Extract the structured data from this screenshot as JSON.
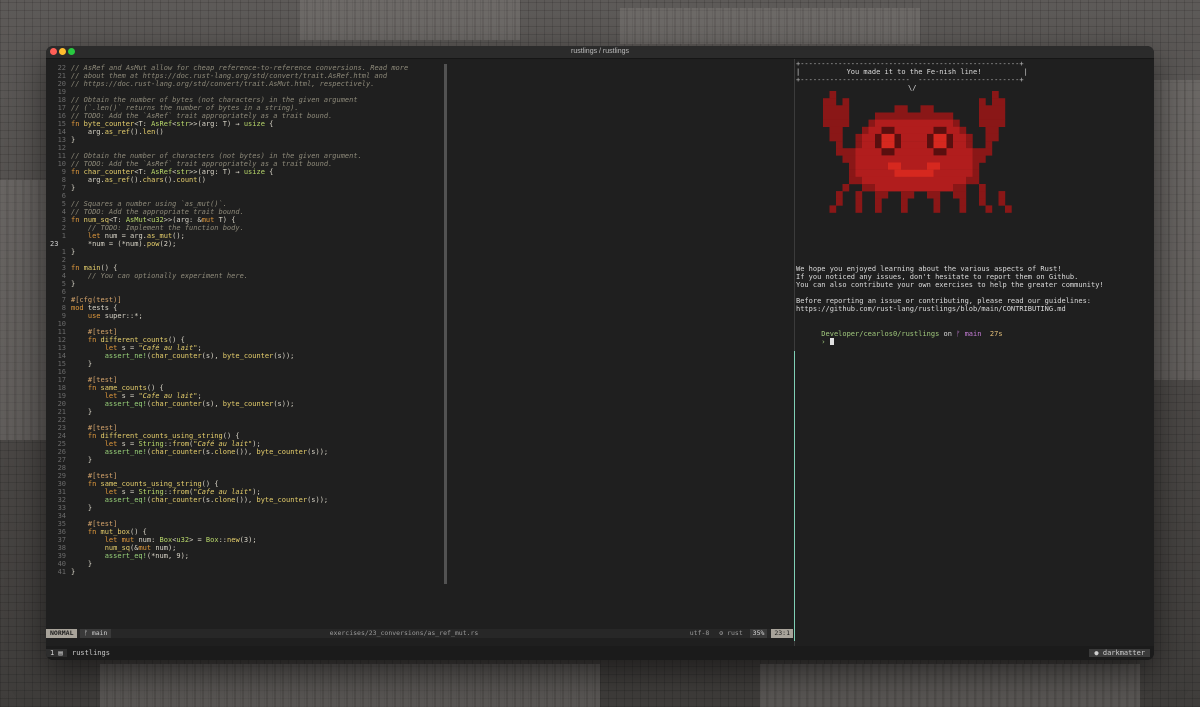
{
  "window": {
    "title": "rustlings / rustlings"
  },
  "editor": {
    "lines": [
      {
        "n": "22",
        "segs": [
          {
            "t": "// ",
            "c": "c-com"
          },
          {
            "t": "AsRef",
            "c": "c-com"
          },
          {
            "t": " and ",
            "c": "c-com"
          },
          {
            "t": "AsMut",
            "c": "c-com"
          },
          {
            "t": " allow for cheap reference-to-reference conversions. Read more",
            "c": "c-com"
          }
        ]
      },
      {
        "n": "21",
        "segs": [
          {
            "t": "// about them at https://doc.rust-lang.org/std/convert/trait.AsRef.html and",
            "c": "c-com"
          }
        ]
      },
      {
        "n": "20",
        "segs": [
          {
            "t": "// https://doc.rust-lang.org/std/convert/trait.AsMut.html, respectively.",
            "c": "c-com"
          }
        ]
      },
      {
        "n": "19",
        "segs": []
      },
      {
        "n": "18",
        "segs": [
          {
            "t": "// Obtain the number of bytes (not characters) in the given argument",
            "c": "c-com"
          }
        ]
      },
      {
        "n": "17",
        "segs": [
          {
            "t": "// (`.len()` returns the number of bytes in a string).",
            "c": "c-com"
          }
        ]
      },
      {
        "n": "16",
        "segs": [
          {
            "t": "// TODO: Add the `AsRef` trait appropriately as a trait bound.",
            "c": "c-com"
          }
        ]
      },
      {
        "n": "15",
        "segs": [
          {
            "t": "fn ",
            "c": "c-kw"
          },
          {
            "t": "byte_counter",
            "c": "c-fn"
          },
          {
            "t": "<T: "
          },
          {
            "t": "AsRef",
            "c": "c-type"
          },
          {
            "t": "<"
          },
          {
            "t": "str",
            "c": "c-type"
          },
          {
            "t": ">>(arg: T) → "
          },
          {
            "t": "usize",
            "c": "c-type"
          },
          {
            "t": " {"
          }
        ]
      },
      {
        "n": "14",
        "segs": [
          {
            "t": "    arg."
          },
          {
            "t": "as_ref",
            "c": "c-fn"
          },
          {
            "t": "()."
          },
          {
            "t": "len",
            "c": "c-fn"
          },
          {
            "t": "()"
          }
        ]
      },
      {
        "n": "13",
        "segs": [
          {
            "t": "}"
          }
        ]
      },
      {
        "n": "12",
        "segs": []
      },
      {
        "n": "11",
        "segs": [
          {
            "t": "// Obtain the number of characters (not bytes) in the given argument.",
            "c": "c-com"
          }
        ]
      },
      {
        "n": "10",
        "segs": [
          {
            "t": "// TODO: Add the `AsRef` trait appropriately as a trait bound.",
            "c": "c-com"
          }
        ]
      },
      {
        "n": "9",
        "segs": [
          {
            "t": "fn ",
            "c": "c-kw"
          },
          {
            "t": "char_counter",
            "c": "c-fn"
          },
          {
            "t": "<T: "
          },
          {
            "t": "AsRef",
            "c": "c-type"
          },
          {
            "t": "<"
          },
          {
            "t": "str",
            "c": "c-type"
          },
          {
            "t": ">>(arg: T) → "
          },
          {
            "t": "usize",
            "c": "c-type"
          },
          {
            "t": " {"
          }
        ]
      },
      {
        "n": "8",
        "segs": [
          {
            "t": "    arg."
          },
          {
            "t": "as_ref",
            "c": "c-fn"
          },
          {
            "t": "()."
          },
          {
            "t": "chars",
            "c": "c-fn"
          },
          {
            "t": "()."
          },
          {
            "t": "count",
            "c": "c-fn"
          },
          {
            "t": "()"
          }
        ]
      },
      {
        "n": "7",
        "segs": [
          {
            "t": "}"
          }
        ]
      },
      {
        "n": "6",
        "segs": []
      },
      {
        "n": "5",
        "segs": [
          {
            "t": "// Squares a number using `as_mut()`.",
            "c": "c-com"
          }
        ]
      },
      {
        "n": "4",
        "segs": [
          {
            "t": "// TODO: Add the appropriate trait bound.",
            "c": "c-com"
          }
        ]
      },
      {
        "n": "3",
        "segs": [
          {
            "t": "fn ",
            "c": "c-kw"
          },
          {
            "t": "num_sq",
            "c": "c-fn"
          },
          {
            "t": "<T: "
          },
          {
            "t": "AsMut",
            "c": "c-type"
          },
          {
            "t": "<"
          },
          {
            "t": "u32",
            "c": "c-type"
          },
          {
            "t": ">>(arg: &"
          },
          {
            "t": "mut",
            "c": "c-kw"
          },
          {
            "t": " T) {"
          }
        ]
      },
      {
        "n": "2",
        "segs": [
          {
            "t": "    "
          },
          {
            "t": "// TODO: Implement the function body.",
            "c": "c-com"
          }
        ]
      },
      {
        "n": "1",
        "segs": [
          {
            "t": "    "
          },
          {
            "t": "let",
            "c": "c-kw"
          },
          {
            "t": " num = arg."
          },
          {
            "t": "as_mut",
            "c": "c-fn"
          },
          {
            "t": "();"
          }
        ]
      },
      {
        "n": "23",
        "cur": true,
        "segs": [
          {
            "t": "    *num = (*num)."
          },
          {
            "t": "pow",
            "c": "c-fn"
          },
          {
            "t": "(2);"
          }
        ]
      },
      {
        "n": "1",
        "segs": [
          {
            "t": "}"
          }
        ]
      },
      {
        "n": "2",
        "segs": []
      },
      {
        "n": "3",
        "segs": [
          {
            "t": "fn ",
            "c": "c-kw"
          },
          {
            "t": "main",
            "c": "c-fn"
          },
          {
            "t": "() {"
          }
        ]
      },
      {
        "n": "4",
        "segs": [
          {
            "t": "    "
          },
          {
            "t": "// You can optionally experiment here.",
            "c": "c-com"
          }
        ]
      },
      {
        "n": "5",
        "segs": [
          {
            "t": "}"
          }
        ]
      },
      {
        "n": "6",
        "segs": []
      },
      {
        "n": "7",
        "segs": [
          {
            "t": "#[cfg(test)]",
            "c": "c-attr"
          }
        ]
      },
      {
        "n": "8",
        "segs": [
          {
            "t": "mod ",
            "c": "c-kw"
          },
          {
            "t": "tests {"
          }
        ]
      },
      {
        "n": "9",
        "segs": [
          {
            "t": "    "
          },
          {
            "t": "use",
            "c": "c-kw"
          },
          {
            "t": " super::*;"
          }
        ]
      },
      {
        "n": "10",
        "segs": []
      },
      {
        "n": "11",
        "segs": [
          {
            "t": "    "
          },
          {
            "t": "#[test]",
            "c": "c-attr"
          }
        ]
      },
      {
        "n": "12",
        "segs": [
          {
            "t": "    "
          },
          {
            "t": "fn ",
            "c": "c-kw"
          },
          {
            "t": "different_counts",
            "c": "c-fn"
          },
          {
            "t": "() {"
          }
        ]
      },
      {
        "n": "13",
        "segs": [
          {
            "t": "        "
          },
          {
            "t": "let",
            "c": "c-kw"
          },
          {
            "t": " s = "
          },
          {
            "t": "\"Café au lait\"",
            "c": "c-str"
          },
          {
            "t": ";"
          }
        ]
      },
      {
        "n": "14",
        "segs": [
          {
            "t": "        "
          },
          {
            "t": "assert_ne!",
            "c": "c-mac"
          },
          {
            "t": "("
          },
          {
            "t": "char_counter",
            "c": "c-fn"
          },
          {
            "t": "(s), "
          },
          {
            "t": "byte_counter",
            "c": "c-fn"
          },
          {
            "t": "(s));"
          }
        ]
      },
      {
        "n": "15",
        "segs": [
          {
            "t": "    }"
          }
        ]
      },
      {
        "n": "16",
        "segs": []
      },
      {
        "n": "17",
        "segs": [
          {
            "t": "    "
          },
          {
            "t": "#[test]",
            "c": "c-attr"
          }
        ]
      },
      {
        "n": "18",
        "segs": [
          {
            "t": "    "
          },
          {
            "t": "fn ",
            "c": "c-kw"
          },
          {
            "t": "same_counts",
            "c": "c-fn"
          },
          {
            "t": "() {"
          }
        ]
      },
      {
        "n": "19",
        "segs": [
          {
            "t": "        "
          },
          {
            "t": "let",
            "c": "c-kw"
          },
          {
            "t": " s = "
          },
          {
            "t": "\"Cafe au lait\"",
            "c": "c-str"
          },
          {
            "t": ";"
          }
        ]
      },
      {
        "n": "20",
        "segs": [
          {
            "t": "        "
          },
          {
            "t": "assert_eq!",
            "c": "c-mac"
          },
          {
            "t": "("
          },
          {
            "t": "char_counter",
            "c": "c-fn"
          },
          {
            "t": "(s), "
          },
          {
            "t": "byte_counter",
            "c": "c-fn"
          },
          {
            "t": "(s));"
          }
        ]
      },
      {
        "n": "21",
        "segs": [
          {
            "t": "    }"
          }
        ]
      },
      {
        "n": "22",
        "segs": []
      },
      {
        "n": "23",
        "segs": [
          {
            "t": "    "
          },
          {
            "t": "#[test]",
            "c": "c-attr"
          }
        ]
      },
      {
        "n": "24",
        "segs": [
          {
            "t": "    "
          },
          {
            "t": "fn ",
            "c": "c-kw"
          },
          {
            "t": "different_counts_using_string",
            "c": "c-fn"
          },
          {
            "t": "() {"
          }
        ]
      },
      {
        "n": "25",
        "segs": [
          {
            "t": "        "
          },
          {
            "t": "let",
            "c": "c-kw"
          },
          {
            "t": " s = "
          },
          {
            "t": "String",
            "c": "c-type"
          },
          {
            "t": "::"
          },
          {
            "t": "from",
            "c": "c-fn"
          },
          {
            "t": "("
          },
          {
            "t": "\"Café au lait\"",
            "c": "c-str"
          },
          {
            "t": ");"
          }
        ]
      },
      {
        "n": "26",
        "segs": [
          {
            "t": "        "
          },
          {
            "t": "assert_ne!",
            "c": "c-mac"
          },
          {
            "t": "("
          },
          {
            "t": "char_counter",
            "c": "c-fn"
          },
          {
            "t": "(s."
          },
          {
            "t": "clone",
            "c": "c-fn"
          },
          {
            "t": "()), "
          },
          {
            "t": "byte_counter",
            "c": "c-fn"
          },
          {
            "t": "(s));"
          }
        ]
      },
      {
        "n": "27",
        "segs": [
          {
            "t": "    }"
          }
        ]
      },
      {
        "n": "28",
        "segs": []
      },
      {
        "n": "29",
        "segs": [
          {
            "t": "    "
          },
          {
            "t": "#[test]",
            "c": "c-attr"
          }
        ]
      },
      {
        "n": "30",
        "segs": [
          {
            "t": "    "
          },
          {
            "t": "fn ",
            "c": "c-kw"
          },
          {
            "t": "same_counts_using_string",
            "c": "c-fn"
          },
          {
            "t": "() {"
          }
        ]
      },
      {
        "n": "31",
        "segs": [
          {
            "t": "        "
          },
          {
            "t": "let",
            "c": "c-kw"
          },
          {
            "t": " s = "
          },
          {
            "t": "String",
            "c": "c-type"
          },
          {
            "t": "::"
          },
          {
            "t": "from",
            "c": "c-fn"
          },
          {
            "t": "("
          },
          {
            "t": "\"Cafe au lait\"",
            "c": "c-str"
          },
          {
            "t": ");"
          }
        ]
      },
      {
        "n": "32",
        "segs": [
          {
            "t": "        "
          },
          {
            "t": "assert_eq!",
            "c": "c-mac"
          },
          {
            "t": "("
          },
          {
            "t": "char_counter",
            "c": "c-fn"
          },
          {
            "t": "(s."
          },
          {
            "t": "clone",
            "c": "c-fn"
          },
          {
            "t": "()), "
          },
          {
            "t": "byte_counter",
            "c": "c-fn"
          },
          {
            "t": "(s));"
          }
        ]
      },
      {
        "n": "33",
        "segs": [
          {
            "t": "    }"
          }
        ]
      },
      {
        "n": "34",
        "segs": []
      },
      {
        "n": "35",
        "segs": [
          {
            "t": "    "
          },
          {
            "t": "#[test]",
            "c": "c-attr"
          }
        ]
      },
      {
        "n": "36",
        "segs": [
          {
            "t": "    "
          },
          {
            "t": "fn ",
            "c": "c-kw"
          },
          {
            "t": "mut_box",
            "c": "c-fn"
          },
          {
            "t": "() {"
          }
        ]
      },
      {
        "n": "37",
        "segs": [
          {
            "t": "        "
          },
          {
            "t": "let mut",
            "c": "c-kw"
          },
          {
            "t": " num: "
          },
          {
            "t": "Box",
            "c": "c-type"
          },
          {
            "t": "<"
          },
          {
            "t": "u32",
            "c": "c-type"
          },
          {
            "t": "> = "
          },
          {
            "t": "Box",
            "c": "c-type"
          },
          {
            "t": "::"
          },
          {
            "t": "new",
            "c": "c-fn"
          },
          {
            "t": "(3);"
          }
        ]
      },
      {
        "n": "38",
        "segs": [
          {
            "t": "        "
          },
          {
            "t": "num_sq",
            "c": "c-fn"
          },
          {
            "t": "(&"
          },
          {
            "t": "mut",
            "c": "c-kw"
          },
          {
            "t": " num);"
          }
        ]
      },
      {
        "n": "39",
        "segs": [
          {
            "t": "        "
          },
          {
            "t": "assert_eq!",
            "c": "c-mac"
          },
          {
            "t": "(*num, 9);"
          }
        ]
      },
      {
        "n": "40",
        "segs": [
          {
            "t": "    }"
          }
        ]
      },
      {
        "n": "41",
        "segs": [
          {
            "t": "}"
          }
        ]
      }
    ]
  },
  "statusbar": {
    "mode": "NORMAL",
    "branch": "ᚠ main",
    "file": "exercises/23_conversions/as_ref_mut.rs",
    "encoding": "utf-8",
    "filetype": "⚙ rust",
    "percent": "35%",
    "position": "23:1"
  },
  "terminal": {
    "banner_top": "+----------------------------------------------------+",
    "banner_msg": "|           You made it to the Fe-nish line!          |",
    "banner_bottom": "+--------------------------  ------------------------+",
    "banner_tail": "\\/",
    "messages": [
      "We hope you enjoyed learning about the various aspects of Rust!",
      "If you noticed any issues, don't hesitate to report them on Github.",
      "You can also contribute your own exercises to help the greater community!",
      "",
      "Before reporting an issue or contributing, please read our guidelines:",
      "https://github.com/rust-lang/rustlings/blob/main/CONTRIBUTING.md"
    ],
    "prompt": {
      "path": "Developer/cearlos0/rustlings",
      "on": " on ",
      "branch": "ᚠ main",
      "time": "27s",
      "arrow": "›"
    }
  },
  "tmux": {
    "window_index": "1 ▤",
    "session": "rustlings",
    "theme": "● darkmatter"
  },
  "colors": {
    "crab_dark": "#8a1717",
    "crab_mid": "#b11d1d",
    "crab_eye": "#d6281f",
    "accent_green": "#7fcfb5"
  }
}
